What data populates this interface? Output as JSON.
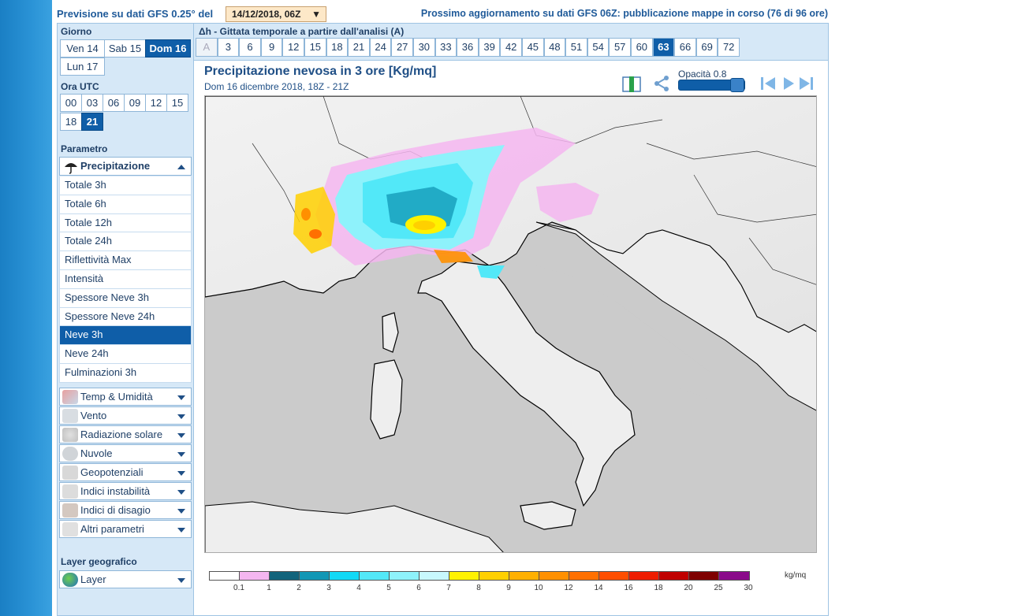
{
  "header": {
    "prefix": "Previsione su dati GFS 0.25° del",
    "date_select": "14/12/2018, 06Z",
    "next_update": "Prossimo aggiornamento su dati GFS 06Z: pubblicazione mappe in corso (76 di 96 ore)"
  },
  "sidebar": {
    "day_label": "Giorno",
    "days": [
      "Ven 14",
      "Sab 15",
      "Dom 16",
      "Lun 17"
    ],
    "selected_day": "Dom 16",
    "hour_label": "Ora UTC",
    "hours": [
      "00",
      "03",
      "06",
      "09",
      "12",
      "15",
      "18",
      "21"
    ],
    "selected_hour": "21",
    "param_label": "Parametro",
    "param_group": "Precipitazione",
    "param_items": [
      "Totale 3h",
      "Totale 6h",
      "Totale 12h",
      "Totale 24h",
      "Riflettività Max",
      "Intensità",
      "Spessore Neve 3h",
      "Spessore Neve 24h",
      "Neve 3h",
      "Neve 24h",
      "Fulminazioni 3h"
    ],
    "selected_param": "Neve 3h",
    "categories": [
      "Temp & Umidità",
      "Vento",
      "Radiazione solare",
      "Nuvole",
      "Geopotenziali",
      "Indici instabilità",
      "Indici di disagio",
      "Altri parametri"
    ],
    "layer_label": "Layer geografico",
    "layer_button": "Layer"
  },
  "timebar": {
    "title": "Δh - Gittata temporale a partire dall'analisi (A)",
    "steps": [
      "A",
      "3",
      "6",
      "9",
      "12",
      "15",
      "18",
      "21",
      "24",
      "27",
      "30",
      "33",
      "36",
      "39",
      "42",
      "45",
      "48",
      "51",
      "54",
      "57",
      "60",
      "63",
      "66",
      "69",
      "72"
    ],
    "selected": "63"
  },
  "map": {
    "title": "Precipitazione nevosa in 3 ore [Kg/mq]",
    "subtitle": "Dom 16 dicembre 2018, 18Z - 21Z",
    "opacity_label": "Opacità 0.8",
    "opacity_value": 0.8
  },
  "legend": {
    "unit": "kg/mq",
    "ticks": [
      "0.1",
      "1",
      "2",
      "3",
      "4",
      "5",
      "6",
      "7",
      "8",
      "9",
      "10",
      "12",
      "14",
      "16",
      "18",
      "20",
      "25",
      "30"
    ],
    "colors": [
      "#ffffff",
      "#f4b6f0",
      "#12647c",
      "#1197b5",
      "#11d9f6",
      "#52e8f8",
      "#8ef2fb",
      "#c8f8fd",
      "#fff200",
      "#ffd000",
      "#ffb000",
      "#ff9000",
      "#ff7000",
      "#ff4e00",
      "#ee1c00",
      "#c00000",
      "#7f0000",
      "#8a0a8a"
    ]
  }
}
